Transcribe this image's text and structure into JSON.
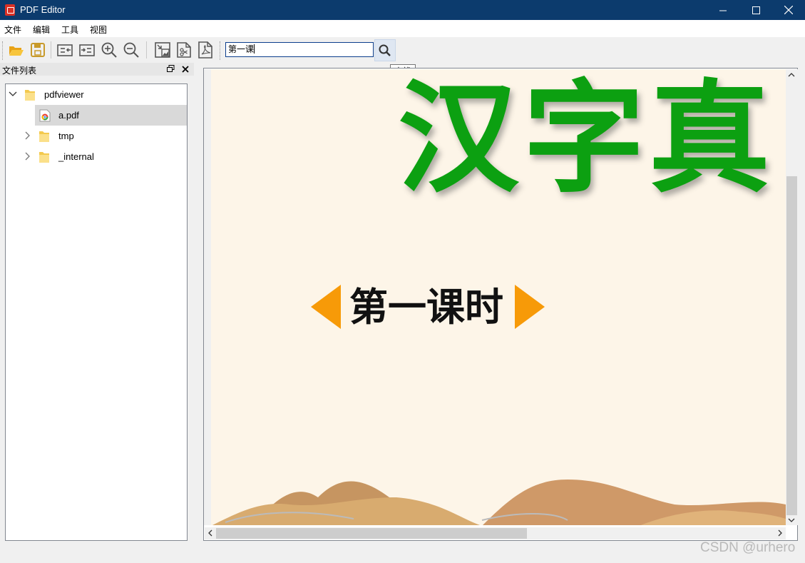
{
  "window": {
    "title": "PDF Editor"
  },
  "menu": {
    "items": [
      "文件",
      "编辑",
      "工具",
      "视图"
    ]
  },
  "toolbar": {
    "icons": [
      "open-folder-icon",
      "save-icon",
      "split-icon",
      "merge-icon",
      "zoom-in-icon",
      "zoom-out-icon",
      "pdf-to-image-icon",
      "extract-pages-icon",
      "export-pdf-icon"
    ],
    "search_value": "第一课",
    "search_icon": "search-icon",
    "search_tooltip": "查找"
  },
  "dock": {
    "title": "文件列表"
  },
  "file_tree": {
    "items": [
      {
        "label": "pdfviewer",
        "type": "folder",
        "expanded": true
      },
      {
        "label": "a.pdf",
        "type": "pdf-file",
        "selected": true
      },
      {
        "label": "tmp",
        "type": "folder",
        "expanded": false
      },
      {
        "label": "_internal",
        "type": "folder",
        "expanded": false
      }
    ]
  },
  "document": {
    "heading": "汉字真",
    "lesson": "第一课时",
    "colors": {
      "heading": "#0ca011",
      "arrows": "#f79a08",
      "page_bg": "#fdf5e8"
    }
  },
  "watermark": "CSDN @urhero"
}
